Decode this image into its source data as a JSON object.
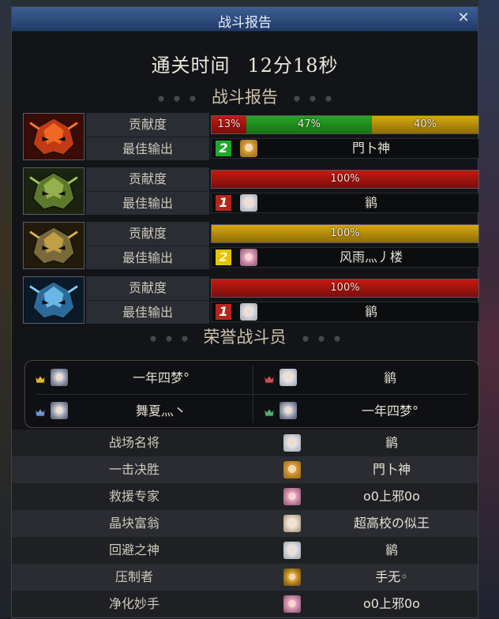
{
  "window": {
    "title": "战斗报告",
    "close_label": "✕"
  },
  "clear_time": {
    "label": "通关时间",
    "value": "12分18秒"
  },
  "report_header": "战斗报告",
  "dungeons": [
    {
      "boss_icon": "red-flame-mask-icon",
      "contribution_label": "贡献度",
      "best_dps_label": "最佳输出",
      "contribution": [
        {
          "text": "13%",
          "value": 13,
          "color": "red"
        },
        {
          "text": "47%",
          "value": 47,
          "color": "green"
        },
        {
          "text": "40%",
          "value": 40,
          "color": "gold"
        }
      ],
      "best": {
        "rank": "2",
        "rank_color": "green",
        "portrait": "p-blonde",
        "name": "門卜神"
      }
    },
    {
      "boss_icon": "green-thorn-mask-icon",
      "contribution_label": "贡献度",
      "best_dps_label": "最佳输出",
      "contribution": [
        {
          "text": "100%",
          "value": 100,
          "color": "red"
        }
      ],
      "best": {
        "rank": "1",
        "rank_color": "red",
        "portrait": "p-white",
        "name": "鹟"
      }
    },
    {
      "boss_icon": "gold-horn-mask-icon",
      "contribution_label": "贡献度",
      "best_dps_label": "最佳输出",
      "contribution": [
        {
          "text": "100%",
          "value": 100,
          "color": "gold"
        }
      ],
      "best": {
        "rank": "2",
        "rank_color": "yellow",
        "portrait": "p-pink",
        "name": "风雨灬丿楼"
      }
    },
    {
      "boss_icon": "blue-crystal-mask-icon",
      "contribution_label": "贡献度",
      "best_dps_label": "最佳输出",
      "contribution": [
        {
          "text": "100%",
          "value": 100,
          "color": "red"
        }
      ],
      "best": {
        "rank": "1",
        "rank_color": "red",
        "portrait": "p-white",
        "name": "鹟"
      }
    }
  ],
  "honor_header": "荣誉战斗员",
  "honor": [
    {
      "medal": "gold-medal-icon",
      "portrait": "p-silver",
      "name": "一年四梦°"
    },
    {
      "medal": "red-medal-icon",
      "portrait": "p-white",
      "name": "鹟"
    },
    {
      "medal": "blue-medal-icon",
      "portrait": "p-silver",
      "name": "舞夏灬丶"
    },
    {
      "medal": "green-medal-icon",
      "portrait": "p-silver",
      "name": "一年四梦°"
    }
  ],
  "awards": [
    {
      "title": "战场名将",
      "portrait": "p-white",
      "name": "鹟"
    },
    {
      "title": "一击决胜",
      "portrait": "p-blonde",
      "name": "門卜神"
    },
    {
      "title": "救援专家",
      "portrait": "p-pink",
      "name": "o0上邪0o"
    },
    {
      "title": "晶块富翁",
      "portrait": "p-cream",
      "name": "超高校の似王"
    },
    {
      "title": "回避之神",
      "portrait": "p-white",
      "name": "鹟"
    },
    {
      "title": "压制者",
      "portrait": "p-gold",
      "name": "手无◦"
    },
    {
      "title": "净化妙手",
      "portrait": "p-pink",
      "name": "o0上邪0o"
    }
  ],
  "colors": {
    "bar_red": "#c41a12",
    "bar_green": "#2aa328",
    "bar_gold": "#d8a90f",
    "title_bar": "#2f4e80"
  }
}
